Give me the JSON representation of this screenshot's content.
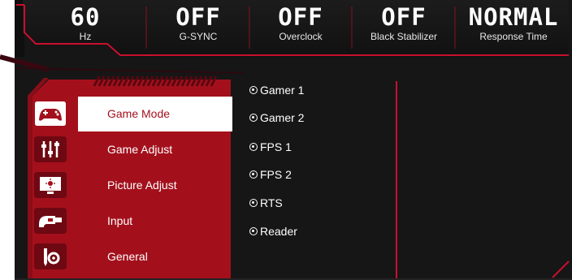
{
  "status_bar": [
    {
      "value": "60",
      "label": "Hz"
    },
    {
      "value": "OFF",
      "label": "G-SYNC"
    },
    {
      "value": "OFF",
      "label": "Overclock"
    },
    {
      "value": "OFF",
      "label": "Black Stabilizer"
    },
    {
      "value": "NORMAL",
      "label": "Response Time"
    }
  ],
  "menu": {
    "items": [
      {
        "label": "Game Mode",
        "icon": "gamepad-icon",
        "active": true
      },
      {
        "label": "Game Adjust",
        "icon": "sliders-icon",
        "active": false
      },
      {
        "label": "Picture Adjust",
        "icon": "picture-icon",
        "active": false
      },
      {
        "label": "Input",
        "icon": "input-plug-icon",
        "active": false
      },
      {
        "label": "General",
        "icon": "tools-icon",
        "active": false
      }
    ]
  },
  "options": [
    {
      "label": "Gamer 1"
    },
    {
      "label": "Gamer 2"
    },
    {
      "label": "FPS 1"
    },
    {
      "label": "FPS 2"
    },
    {
      "label": "RTS"
    },
    {
      "label": "Reader"
    }
  ],
  "colors": {
    "accent": "#c8102e",
    "panel": "#a3101c",
    "background": "#161616"
  }
}
